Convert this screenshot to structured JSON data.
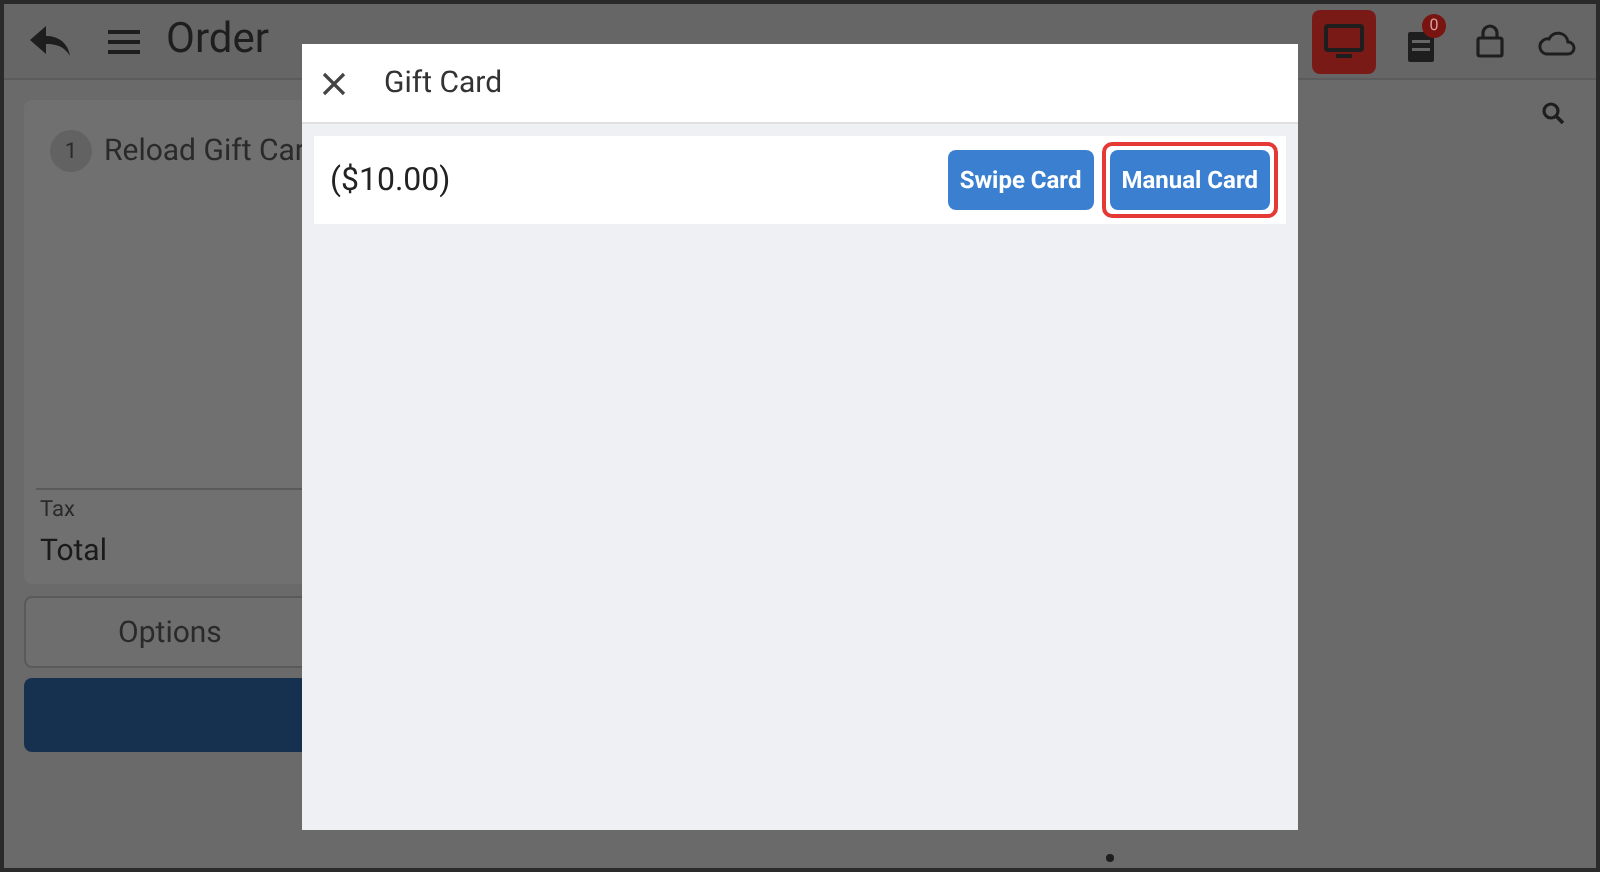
{
  "header": {
    "title": "Order",
    "notification_count": "0"
  },
  "order": {
    "items": [
      {
        "quantity": "1",
        "name": "Reload Gift Car"
      }
    ],
    "tax_label": "Tax",
    "total_label": "Total",
    "options_button": "Options"
  },
  "dialog": {
    "title": "Gift Card",
    "amount": "($10.00)",
    "buttons": [
      {
        "label": "Swipe Card",
        "highlighted": false
      },
      {
        "label": "Manual Card",
        "highlighted": true
      }
    ]
  }
}
